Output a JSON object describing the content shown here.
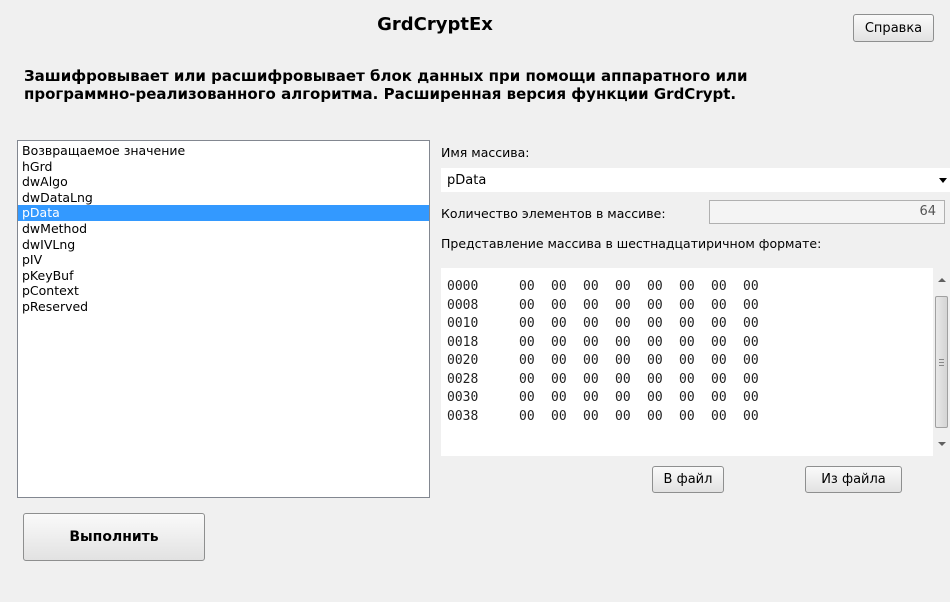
{
  "window": {
    "title": "GrdCryptEx"
  },
  "header": {
    "help_label": "Справка",
    "description_line1": "Зашифровывает или расшифровывает блок данных при помощи аппаратного или",
    "description_line2": "программно-реализованного алгоритма. Расширенная версия функции GrdCrypt."
  },
  "params_list": {
    "selected": "pData",
    "items": [
      "Возвращаемое значение",
      "hGrd",
      "dwAlgo",
      "dwDataLng",
      "pData",
      "dwMethod",
      "dwIVLng",
      "pIV",
      "pKeyBuf",
      "pContext",
      "pReserved"
    ]
  },
  "array_panel": {
    "name_label": "Имя массива:",
    "name_value": "pData",
    "count_label": "Количество элементов в массиве:",
    "count_value": "64",
    "hex_label": "Представление массива в шестнадцатиричном формате:",
    "hex_rows": [
      {
        "addr": "0000",
        "bytes": [
          "00",
          "00",
          "00",
          "00",
          "00",
          "00",
          "00",
          "00"
        ]
      },
      {
        "addr": "0008",
        "bytes": [
          "00",
          "00",
          "00",
          "00",
          "00",
          "00",
          "00",
          "00"
        ]
      },
      {
        "addr": "0010",
        "bytes": [
          "00",
          "00",
          "00",
          "00",
          "00",
          "00",
          "00",
          "00"
        ]
      },
      {
        "addr": "0018",
        "bytes": [
          "00",
          "00",
          "00",
          "00",
          "00",
          "00",
          "00",
          "00"
        ]
      },
      {
        "addr": "0020",
        "bytes": [
          "00",
          "00",
          "00",
          "00",
          "00",
          "00",
          "00",
          "00"
        ]
      },
      {
        "addr": "0028",
        "bytes": [
          "00",
          "00",
          "00",
          "00",
          "00",
          "00",
          "00",
          "00"
        ]
      },
      {
        "addr": "0030",
        "bytes": [
          "00",
          "00",
          "00",
          "00",
          "00",
          "00",
          "00",
          "00"
        ]
      },
      {
        "addr": "0038",
        "bytes": [
          "00",
          "00",
          "00",
          "00",
          "00",
          "00",
          "00",
          "00"
        ]
      }
    ],
    "to_file_label": "В файл",
    "from_file_label": "Из файла"
  },
  "footer": {
    "run_label": "Выполнить"
  },
  "colors": {
    "selection": "#3399ff",
    "window_bg": "#f0f0f0"
  },
  "icons": {
    "combo_arrow": "chevron-down-icon",
    "scroll_up": "arrow-up-icon",
    "scroll_down": "arrow-down-icon"
  }
}
